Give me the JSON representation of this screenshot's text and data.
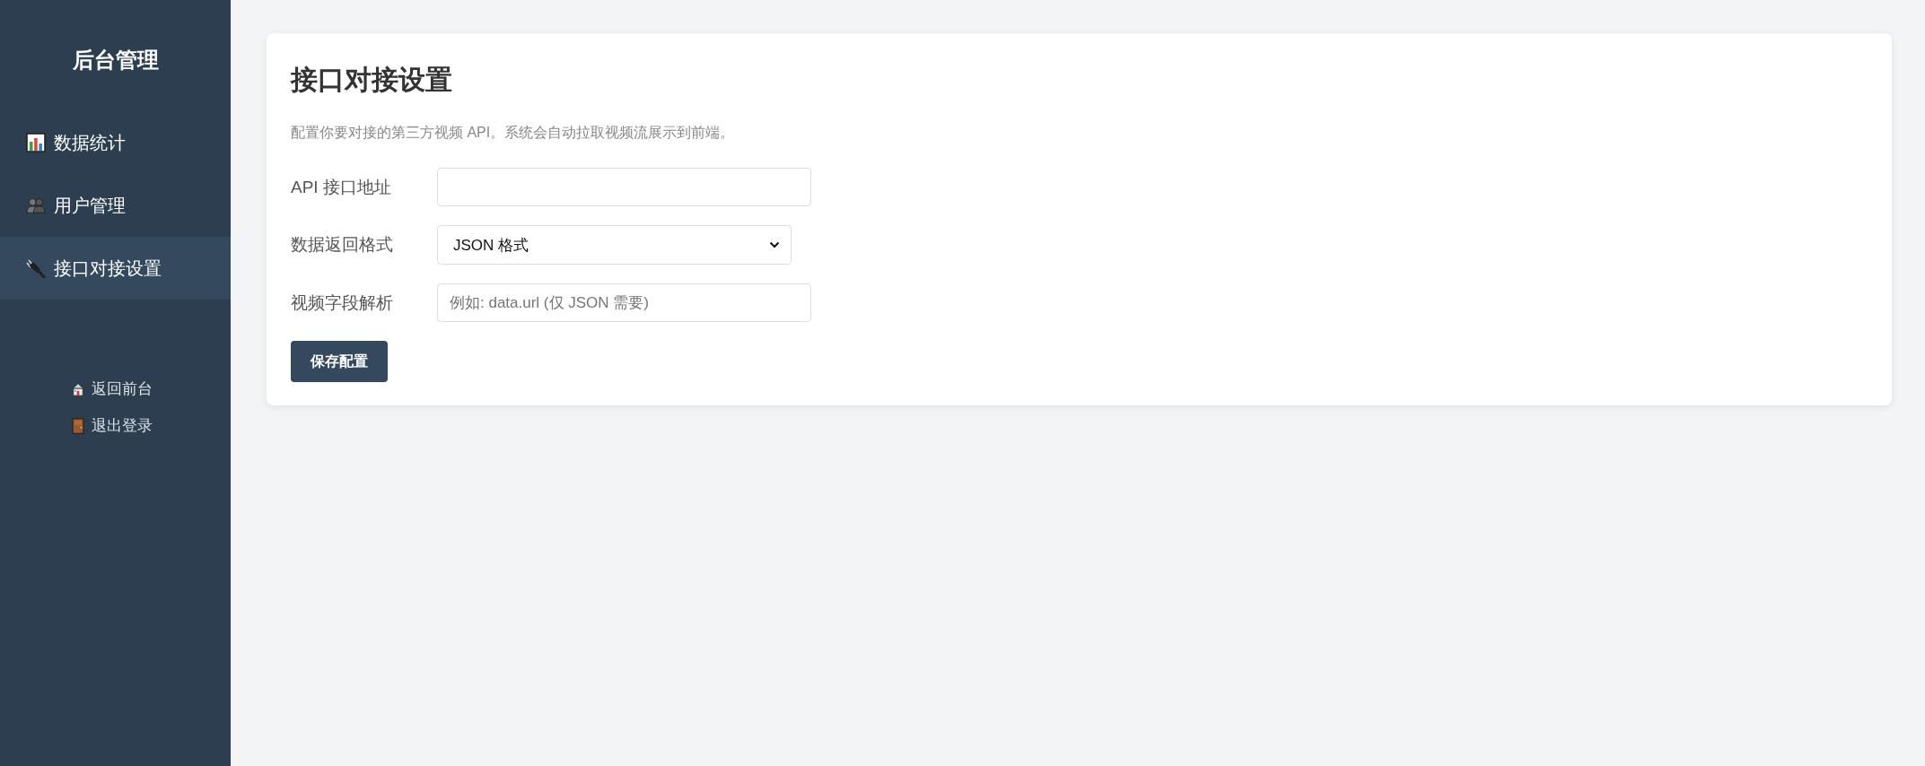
{
  "sidebar": {
    "title": "后台管理",
    "items": [
      {
        "label": "数据统计",
        "selected": false
      },
      {
        "label": "用户管理",
        "selected": false
      },
      {
        "label": "接口对接设置",
        "selected": true
      }
    ],
    "links": [
      {
        "label": "返回前台"
      },
      {
        "label": "退出登录"
      }
    ]
  },
  "page": {
    "title": "接口对接设置",
    "description": "配置你要对接的第三方视频 API。系统会自动拉取视频流展示到前端。",
    "fields": [
      {
        "kind": "input",
        "label": "API 接口地址"
      },
      {
        "kind": "select",
        "label": "数据返回格式",
        "value": "JSON 格式"
      },
      {
        "kind": "input",
        "label": "视频字段解析",
        "placeholder": "例如: data.url (仅 JSON 需要)"
      }
    ],
    "save_button": "保存配置"
  }
}
